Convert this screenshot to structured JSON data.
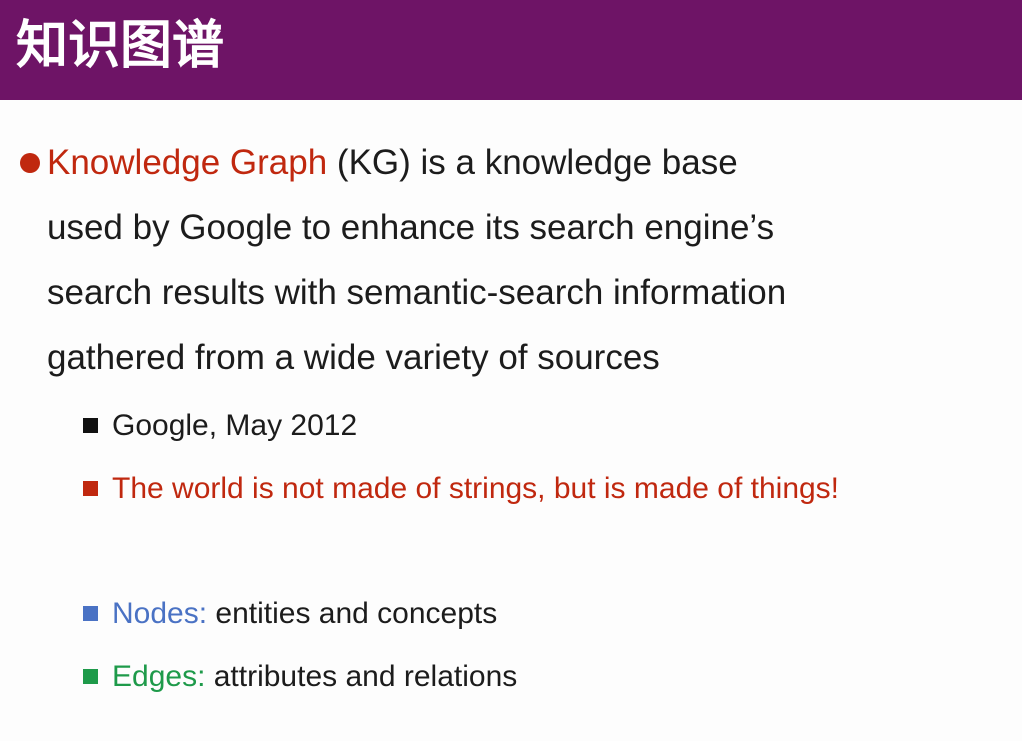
{
  "slide": {
    "title": "知识图谱",
    "colors": {
      "title_bar": "#6e1466",
      "red": "#c0280f",
      "black": "#1c1c1c",
      "blue": "#4a72c4",
      "green": "#1e9a4a"
    },
    "main_bullet": {
      "icon": "round-bullet-icon",
      "term": "Knowledge Graph",
      "line1_rest": " (KG) is a knowledge base",
      "line2": "used by Google to enhance its search engine’s",
      "line3": "search results with semantic-search information",
      "line4": "gathered from a wide variety of sources"
    },
    "sub_items": [
      {
        "icon": "square-bullet-icon",
        "text": "Google, May 2012"
      },
      {
        "icon": "square-bullet-icon",
        "text": "The world is not made of strings, but is made of things!"
      },
      {
        "icon": "square-bullet-icon",
        "term": "Nodes:",
        "text": " entities and concepts"
      },
      {
        "icon": "square-bullet-icon",
        "term": "Edges:",
        "text": " attributes and relations"
      }
    ]
  }
}
